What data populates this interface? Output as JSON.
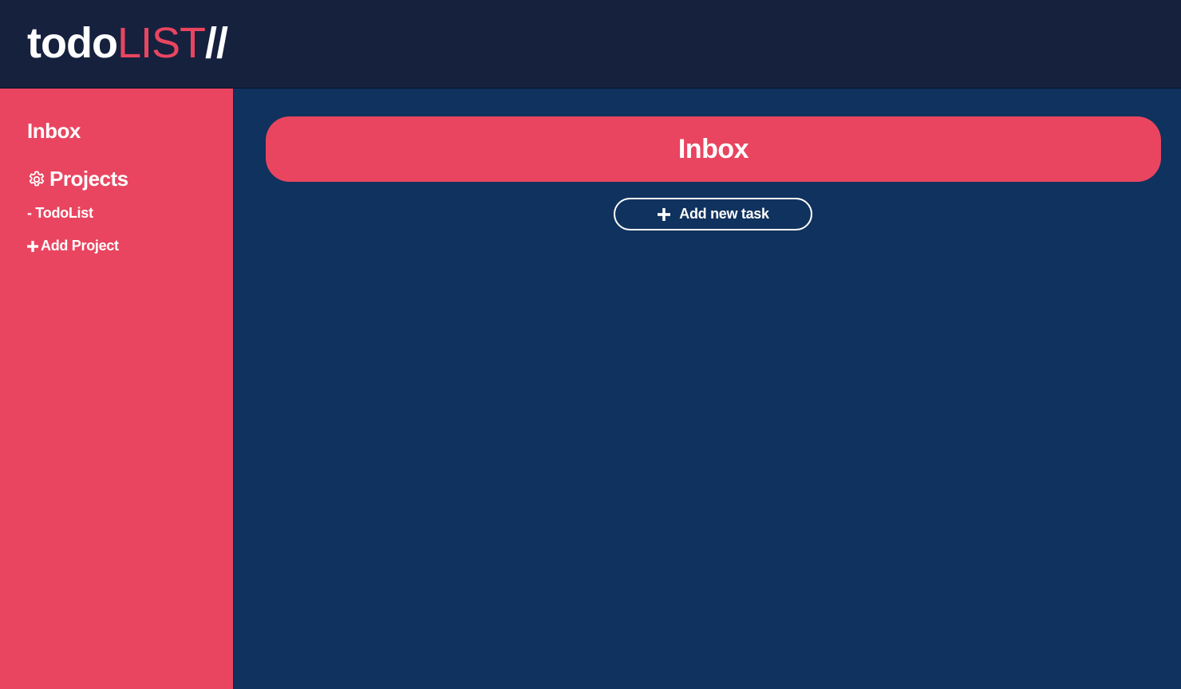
{
  "header": {
    "logo_part1": "todo",
    "logo_part2": "LIST",
    "logo_part3": "//"
  },
  "sidebar": {
    "inbox_label": "Inbox",
    "projects_label": "Projects",
    "projects_icon": "gear-icon",
    "project_items": [
      {
        "label": "- TodoList"
      }
    ],
    "add_project_label": "Add Project",
    "add_project_icon": "plus-icon"
  },
  "main": {
    "title": "Inbox",
    "add_task_label": "Add new task",
    "add_task_icon": "plus-icon"
  },
  "colors": {
    "header_bg": "#16213e",
    "accent": "#e94560",
    "main_bg": "#10325e",
    "text": "#ffffff"
  }
}
